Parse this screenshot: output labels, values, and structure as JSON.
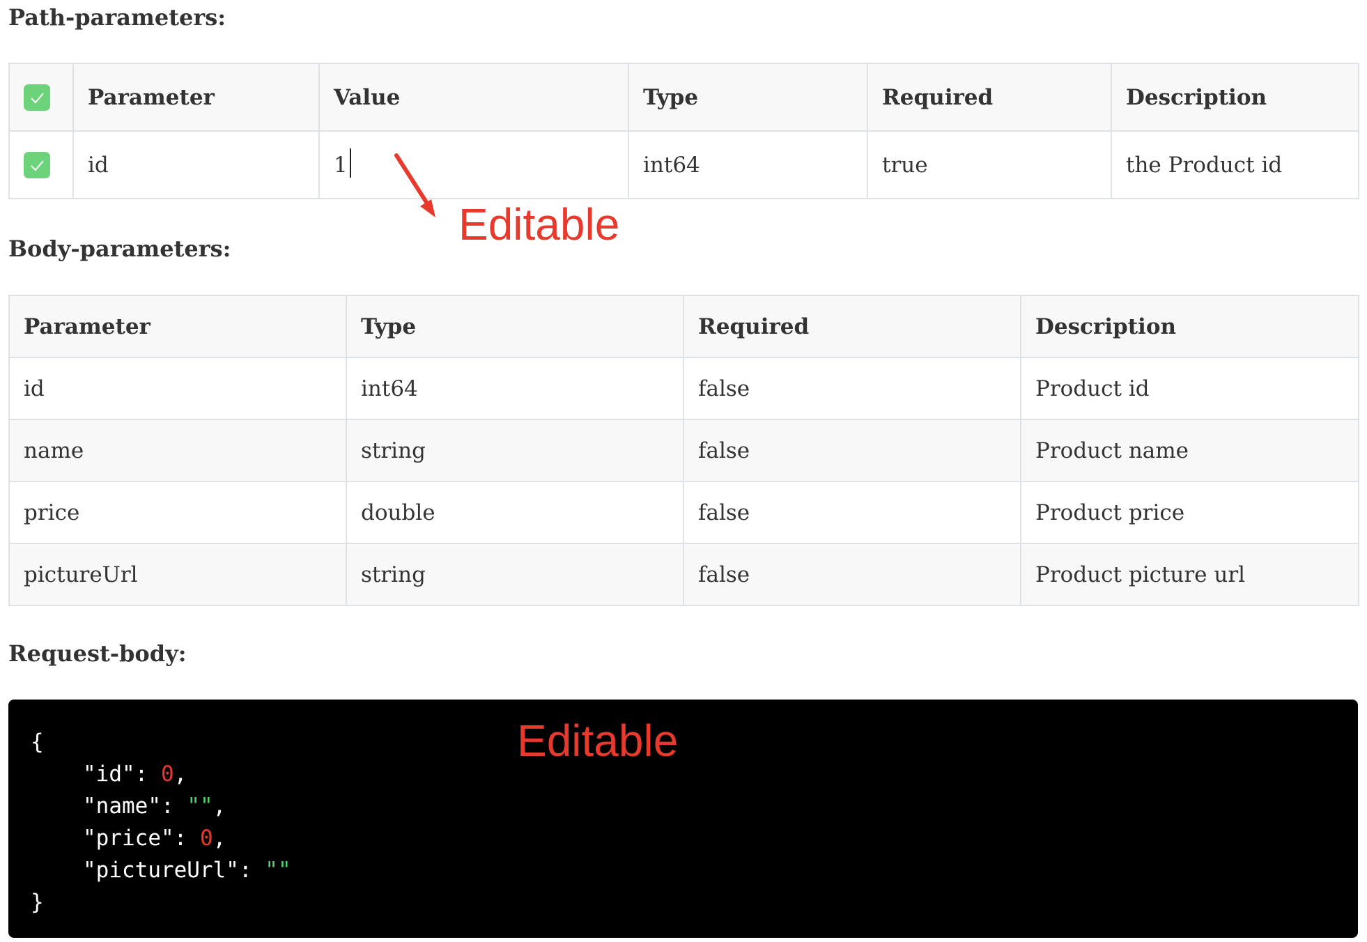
{
  "path_section": {
    "title": "Path-parameters:",
    "columns": [
      "Parameter",
      "Value",
      "Type",
      "Required",
      "Description"
    ],
    "header_checked": true,
    "rows": [
      {
        "checked": true,
        "parameter": "id",
        "value": "1",
        "type": "int64",
        "required": "true",
        "description": "the Product id"
      }
    ]
  },
  "body_section": {
    "title": "Body-parameters:",
    "columns": [
      "Parameter",
      "Type",
      "Required",
      "Description"
    ],
    "rows": [
      {
        "parameter": "id",
        "type": "int64",
        "required": "false",
        "description": "Product id"
      },
      {
        "parameter": "name",
        "type": "string",
        "required": "false",
        "description": "Product name"
      },
      {
        "parameter": "price",
        "type": "double",
        "required": "false",
        "description": "Product price"
      },
      {
        "parameter": "pictureUrl",
        "type": "string",
        "required": "false",
        "description": "Product picture url"
      }
    ]
  },
  "request_section": {
    "title": "Request-body:",
    "code": {
      "open": "{",
      "close": "}",
      "fields": [
        {
          "key": "\"id\"",
          "value": "0",
          "kind": "number",
          "trailing": ","
        },
        {
          "key": "\"name\"",
          "value": "\"\"",
          "kind": "string",
          "trailing": ","
        },
        {
          "key": "\"price\"",
          "value": "0",
          "kind": "number",
          "trailing": ","
        },
        {
          "key": "\"pictureUrl\"",
          "value": "\"\"",
          "kind": "string",
          "trailing": ""
        }
      ]
    }
  },
  "annotations": {
    "value_editable": "Editable",
    "body_editable": "Editable",
    "color": "#e8392d"
  },
  "colors": {
    "check_green": "#6dd37a",
    "code_bg": "#000000",
    "code_number": "#e8392d",
    "code_string": "#4fd06b"
  }
}
